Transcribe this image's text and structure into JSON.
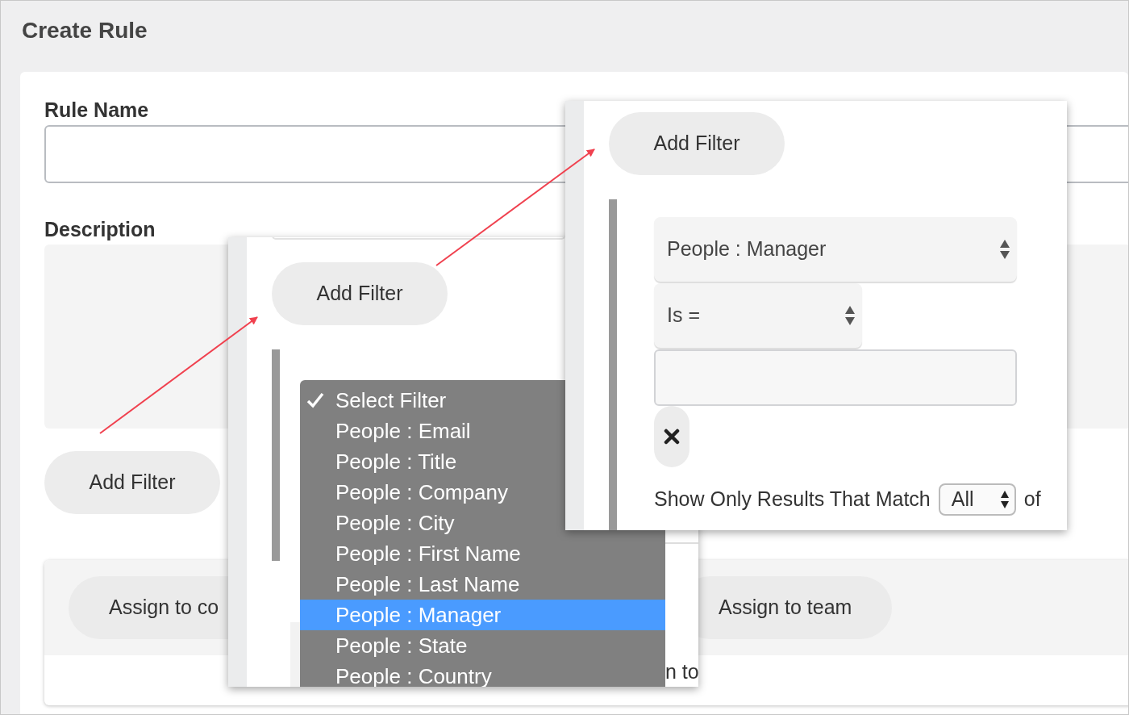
{
  "page": {
    "title": "Create Rule"
  },
  "form": {
    "rule_name_label": "Rule Name",
    "description_label": "Description",
    "add_filter_button": "Add Filter"
  },
  "assign_panel": {
    "buttons": [
      "Assign to co",
      "Assign to team"
    ]
  },
  "popup_dropdown": {
    "add_filter_button": "Add Filter",
    "behind_text": "n to",
    "options": [
      {
        "label": "Select Filter",
        "checked": true,
        "highlighted": false
      },
      {
        "label": "People : Email",
        "checked": false,
        "highlighted": false
      },
      {
        "label": "People : Title",
        "checked": false,
        "highlighted": false
      },
      {
        "label": "People : Company",
        "checked": false,
        "highlighted": false
      },
      {
        "label": "People : City",
        "checked": false,
        "highlighted": false
      },
      {
        "label": "People : First Name",
        "checked": false,
        "highlighted": false
      },
      {
        "label": "People : Last Name",
        "checked": false,
        "highlighted": false
      },
      {
        "label": "People : Manager",
        "checked": false,
        "highlighted": true
      },
      {
        "label": "People : State",
        "checked": false,
        "highlighted": false
      },
      {
        "label": "People : Country",
        "checked": false,
        "highlighted": false
      }
    ]
  },
  "popup_filter": {
    "add_filter_button": "Add Filter",
    "field_select": "People : Manager",
    "operator_select": "Is =",
    "match_label": "Show Only Results That Match",
    "match_select": "All",
    "trailing_text": "of"
  }
}
